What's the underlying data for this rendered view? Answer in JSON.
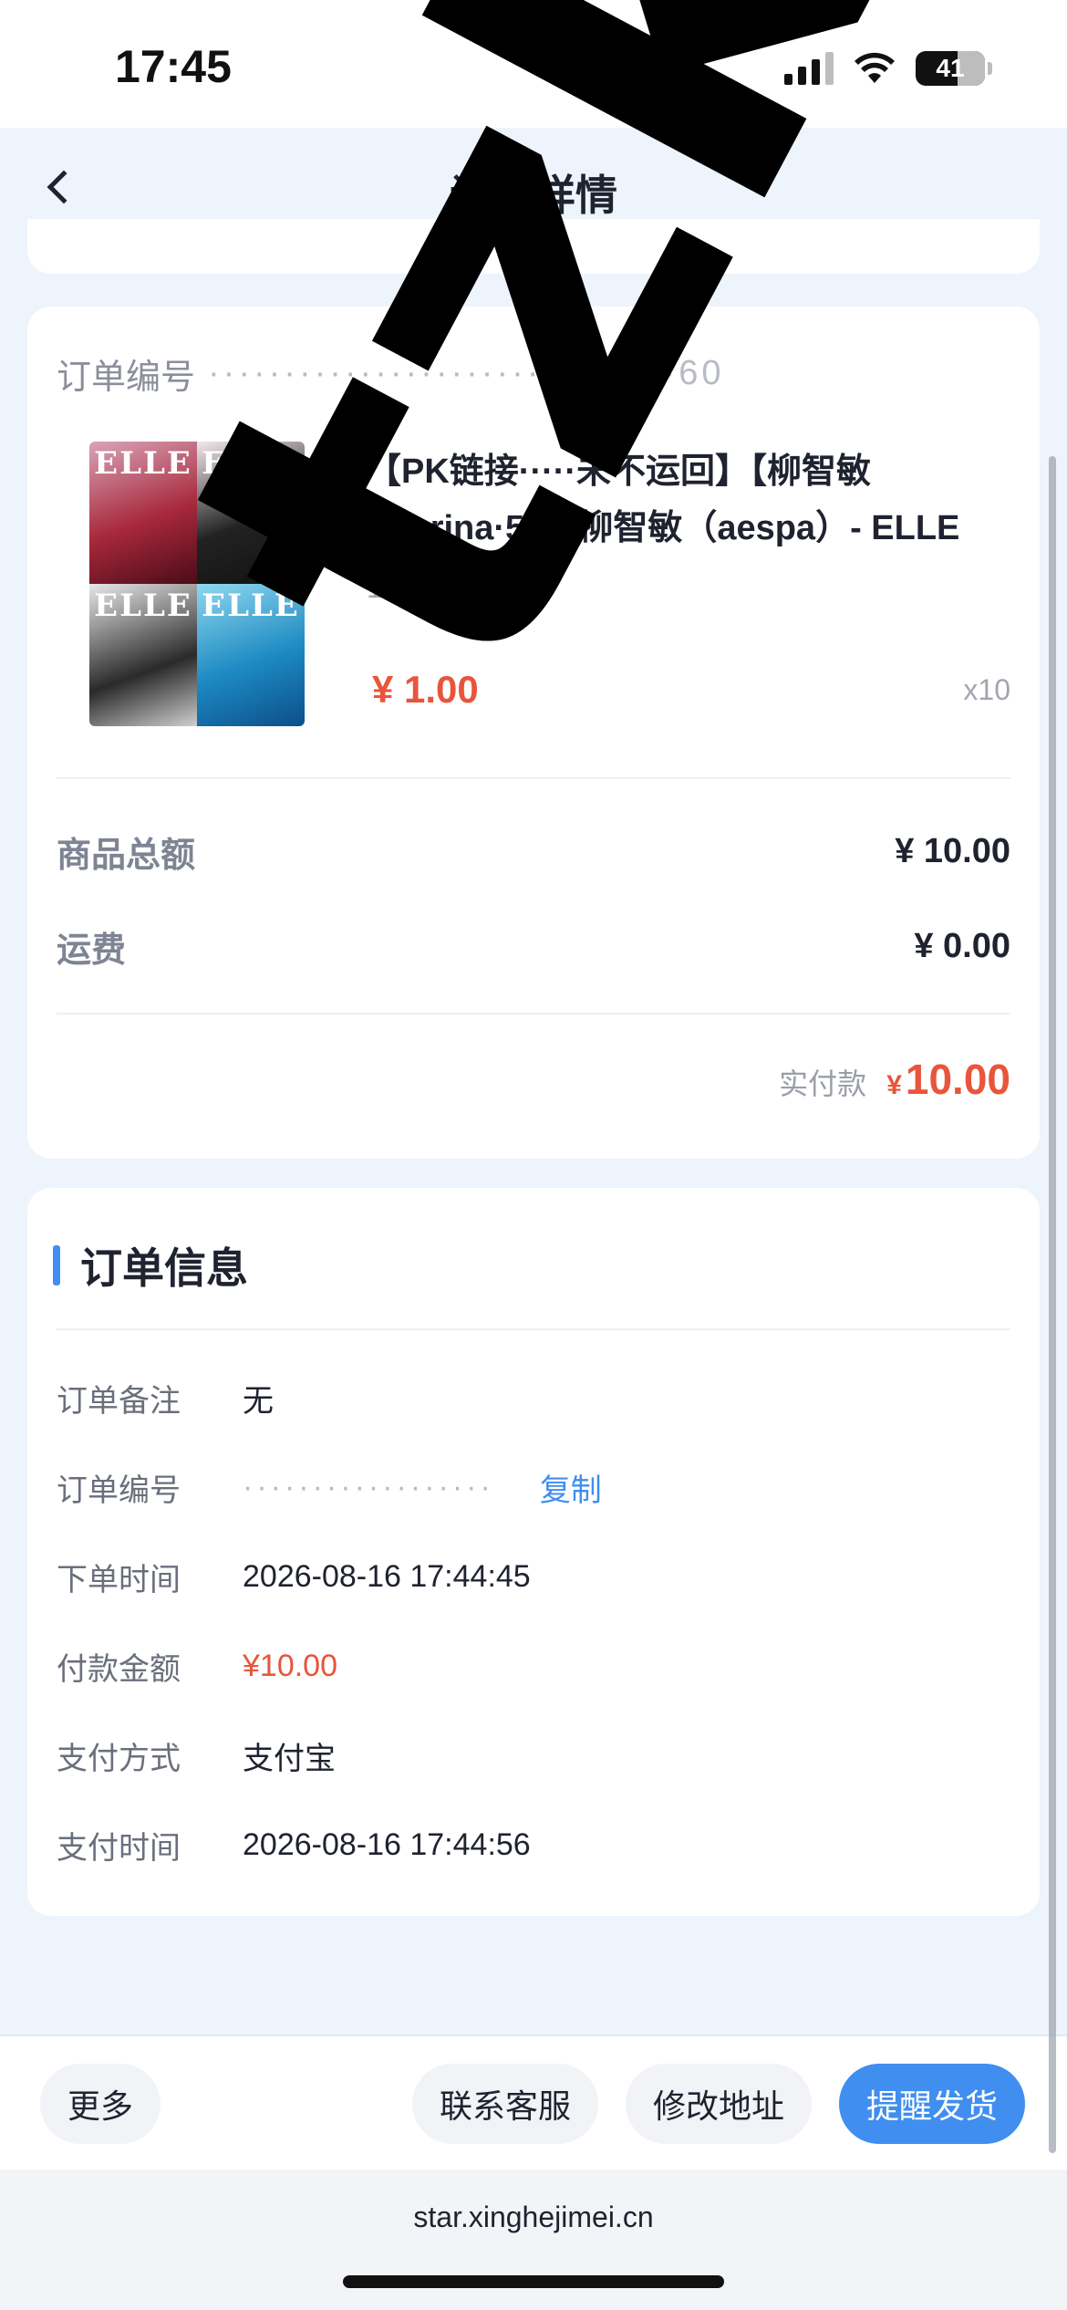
{
  "status_bar": {
    "time": "17:45",
    "battery": "41"
  },
  "nav": {
    "title": "订单详情"
  },
  "order": {
    "order_no_label": "订单编号",
    "order_no_value": "·······························60",
    "product": {
      "cover_text": "ELLE",
      "title": "【PK链接·····未不运回】【柳智敏_Karina·58】柳智敏（aespa）- ELLE",
      "spec": "1 UP",
      "price": "¥ 1.00",
      "qty": "x10"
    },
    "goods_total_label": "商品总额",
    "goods_total_value": "¥ 10.00",
    "shipping_label": "运费",
    "shipping_value": "¥ 0.00",
    "paid_label": "实付款",
    "paid_currency": "¥",
    "paid_value": "10.00"
  },
  "info": {
    "title": "订单信息",
    "rows": [
      {
        "label": "订单备注",
        "value": "无"
      },
      {
        "label": "订单编号",
        "value": "··················",
        "action": "复制"
      },
      {
        "label": "下单时间",
        "value": "2026-08-16 17:44:45"
      },
      {
        "label": "付款金额",
        "value": "¥10.00"
      },
      {
        "label": "支付方式",
        "value": "支付宝"
      },
      {
        "label": "支付时间",
        "value": "2026-08-16 17:44:56"
      }
    ]
  },
  "actions": {
    "more": "更多",
    "service": "联系客服",
    "address": "修改地址",
    "remind": "提醒发货"
  },
  "browser": {
    "url": "star.xinghejimei.cn"
  },
  "watermark": {
    "text": "tzkan"
  }
}
